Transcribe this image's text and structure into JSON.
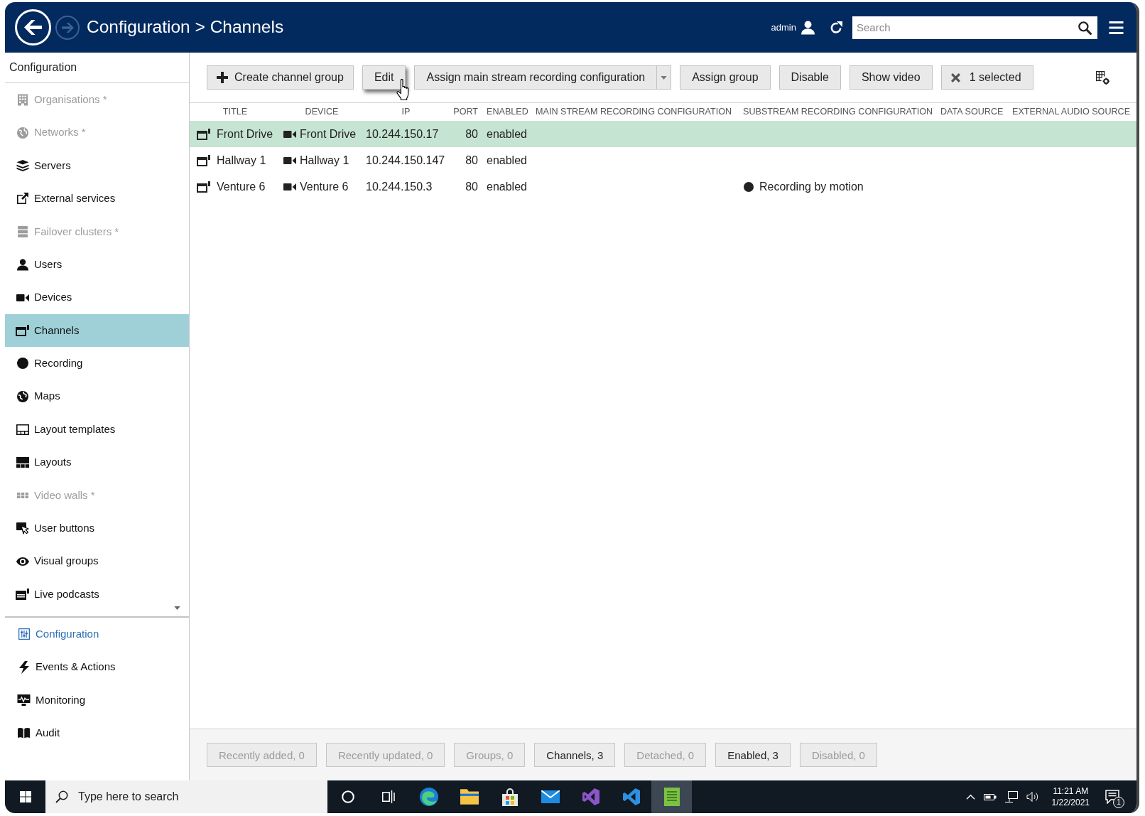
{
  "header": {
    "back": {
      "disabled": false
    },
    "forward": {
      "disabled": true
    },
    "title": "Configuration > Channels",
    "user": "admin",
    "search": {
      "placeholder": "Search"
    }
  },
  "sidebar": {
    "title": "Configuration",
    "items": [
      {
        "label": "Organisations *",
        "disabled": true,
        "selected": false
      },
      {
        "label": "Networks *",
        "disabled": true,
        "selected": false
      },
      {
        "label": "Servers",
        "disabled": false,
        "selected": false
      },
      {
        "label": "External services",
        "disabled": false,
        "selected": false
      },
      {
        "label": "Failover clusters *",
        "disabled": true,
        "selected": false
      },
      {
        "label": "Users",
        "disabled": false,
        "selected": false
      },
      {
        "label": "Devices",
        "disabled": false,
        "selected": false
      },
      {
        "label": "Channels",
        "disabled": false,
        "selected": true
      },
      {
        "label": "Recording",
        "disabled": false,
        "selected": false
      },
      {
        "label": "Maps",
        "disabled": false,
        "selected": false
      },
      {
        "label": "Layout templates",
        "disabled": false,
        "selected": false
      },
      {
        "label": "Layouts",
        "disabled": false,
        "selected": false
      },
      {
        "label": "Video walls *",
        "disabled": true,
        "selected": false
      },
      {
        "label": "User buttons",
        "disabled": false,
        "selected": false
      },
      {
        "label": "Visual groups",
        "disabled": false,
        "selected": false
      },
      {
        "label": "Live podcasts",
        "disabled": false,
        "selected": false
      }
    ],
    "sections": [
      {
        "label": "Configuration",
        "selected": true
      },
      {
        "label": "Events & Actions",
        "selected": false
      },
      {
        "label": "Monitoring",
        "selected": false
      },
      {
        "label": "Audit",
        "selected": false
      }
    ]
  },
  "toolbar": {
    "buttons": [
      {
        "kind": "add",
        "label": "Create channel group",
        "hovered": false
      },
      {
        "kind": "plain",
        "label": "Edit",
        "hovered": true
      },
      {
        "kind": "split",
        "label": "Assign main stream recording configuration",
        "hovered": false
      },
      {
        "kind": "plain",
        "label": "Assign group",
        "hovered": false
      },
      {
        "kind": "plain",
        "label": "Disable",
        "hovered": false
      },
      {
        "kind": "plain",
        "label": "Show video",
        "hovered": false
      },
      {
        "kind": "clear",
        "label": "1 selected",
        "hovered": false
      }
    ]
  },
  "table": {
    "columns": [
      "TITLE",
      "DEVICE",
      "IP",
      "PORT",
      "ENABLED",
      "MAIN STREAM RECORDING CONFIGURATION",
      "SUBSTREAM RECORDING CONFIGURATION",
      "DATA SOURCE",
      "EXTERNAL AUDIO SOURCE"
    ],
    "rows": [
      {
        "selected": true,
        "title": "Front Drive",
        "device": "Front Drive",
        "ip": "10.244.150.17",
        "port": "80",
        "enabled": "enabled"
      },
      {
        "selected": false,
        "title": "Hallway 1",
        "device": "Hallway 1",
        "ip": "10.244.150.147",
        "port": "80",
        "enabled": "enabled"
      },
      {
        "selected": false,
        "title": "Venture 6",
        "device": "Venture 6",
        "ip": "10.244.150.3",
        "port": "80",
        "enabled": "enabled",
        "substream": "Recording by motion"
      }
    ]
  },
  "filters": [
    {
      "label": "Recently added, 0",
      "disabled": true
    },
    {
      "label": "Recently updated, 0",
      "disabled": true
    },
    {
      "label": "Groups, 0",
      "disabled": true
    },
    {
      "label": "Channels, 3",
      "disabled": false
    },
    {
      "label": "Detached, 0",
      "disabled": true
    },
    {
      "label": "Enabled, 3",
      "disabled": false
    },
    {
      "label": "Disabled, 0",
      "disabled": true
    }
  ],
  "taskbar": {
    "search": {
      "placeholder": "Type here to search"
    },
    "apps": [
      {
        "selected": false
      },
      {
        "selected": false
      },
      {
        "selected": false
      },
      {
        "selected": false
      },
      {
        "selected": false
      },
      {
        "selected": false
      },
      {
        "selected": false
      },
      {
        "selected": false
      },
      {
        "selected": true
      }
    ],
    "time": "11:21 AM",
    "date": "1/22/2021",
    "notifications": "1"
  }
}
